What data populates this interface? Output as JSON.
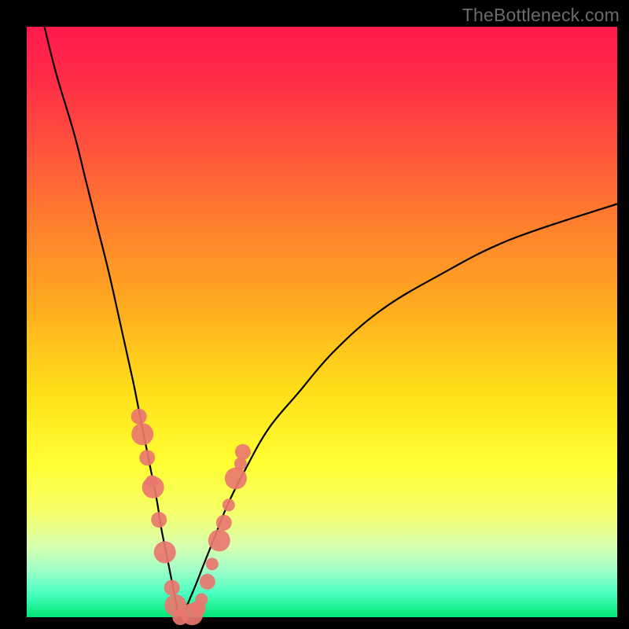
{
  "watermark": "TheBottleneck.com",
  "colors": {
    "frame": "#000000",
    "curve_stroke": "#000000",
    "marker_fill": "#e9776f",
    "gradient_top": "#ff1a4d",
    "gradient_bottom": "#00e676"
  },
  "chart_data": {
    "type": "line",
    "title": "",
    "xlabel": "",
    "ylabel": "",
    "xlim": [
      0,
      100
    ],
    "ylim": [
      0,
      100
    ],
    "notes": "V-shaped bottleneck curve. y ≈ 100 at x≈0 and y≈0 at vertex near x≈26; right branch rises to y≈70 at x=100. Axes unlabeled; values estimated from pixel positions.",
    "series": [
      {
        "name": "left-branch",
        "x": [
          3,
          5,
          8,
          10,
          12,
          14,
          16,
          18,
          19,
          20,
          21,
          22,
          22.8,
          23.6,
          24.4,
          25.2,
          26
        ],
        "y": [
          100,
          92,
          82,
          74,
          66,
          58,
          49,
          40,
          35,
          30,
          25,
          20,
          15,
          11,
          7,
          3,
          0
        ]
      },
      {
        "name": "right-branch",
        "x": [
          26,
          28,
          30,
          32,
          34,
          37,
          41,
          46,
          52,
          60,
          70,
          82,
          100
        ],
        "y": [
          0,
          4,
          9,
          14,
          19,
          25,
          32,
          38,
          45,
          52,
          58,
          64,
          70
        ]
      }
    ],
    "markers": {
      "name": "highlighted-points",
      "x": [
        19.0,
        19.6,
        20.4,
        21.2,
        21.4,
        22.4,
        23.4,
        24.6,
        25.2,
        26.0,
        28.0,
        29.0,
        29.6,
        30.6,
        31.4,
        32.6,
        33.4,
        34.2,
        35.4,
        36.2,
        36.6
      ],
      "y": [
        34.0,
        31.0,
        27.0,
        23.0,
        22.0,
        16.5,
        11.0,
        5.0,
        2.0,
        0.0,
        0.5,
        1.5,
        3.0,
        6.0,
        9.0,
        13.0,
        16.0,
        19.0,
        23.5,
        26.0,
        28.0
      ],
      "radius": [
        10,
        14,
        10,
        8,
        14,
        10,
        14,
        10,
        14,
        10,
        14,
        10,
        8,
        10,
        8,
        14,
        10,
        8,
        14,
        8,
        10
      ]
    }
  }
}
